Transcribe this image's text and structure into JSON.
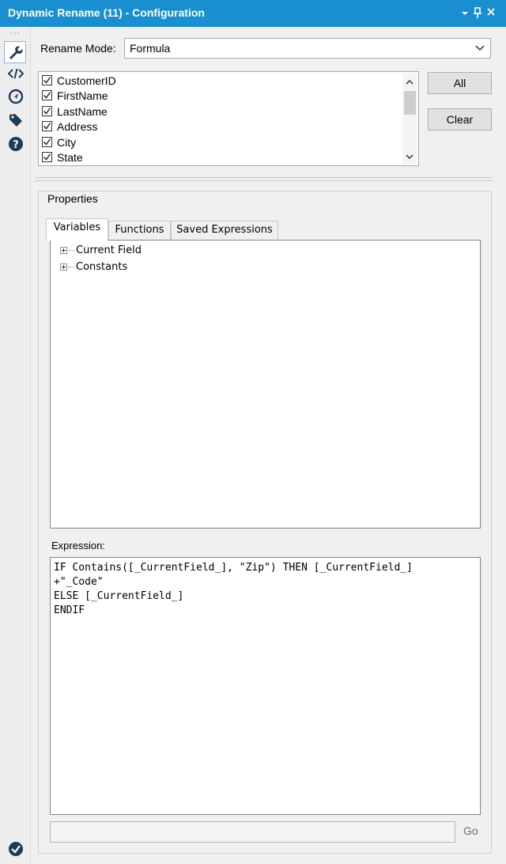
{
  "window": {
    "title": "Dynamic Rename (11) - Configuration",
    "buttons": {
      "dropdown": "▾",
      "pin": "📌",
      "close": "✕"
    }
  },
  "sidebar": {
    "dots": "···",
    "icons": [
      "wrench-icon",
      "code-icon",
      "compass-icon",
      "tag-icon",
      "help-icon"
    ],
    "bottom_icon": "check-circle-icon"
  },
  "rename_mode": {
    "label": "Rename Mode:",
    "value": "Formula"
  },
  "fields": [
    {
      "name": "CustomerID",
      "checked": true
    },
    {
      "name": "FirstName",
      "checked": true
    },
    {
      "name": "LastName",
      "checked": true
    },
    {
      "name": "Address",
      "checked": true
    },
    {
      "name": "City",
      "checked": true
    },
    {
      "name": "State",
      "checked": true
    }
  ],
  "buttons": {
    "all": "All",
    "clear": "Clear",
    "go": "Go"
  },
  "properties": {
    "title": "Properties",
    "tabs": [
      "Variables",
      "Functions",
      "Saved Expressions"
    ],
    "tree": [
      "Current Field",
      "Constants"
    ]
  },
  "expression": {
    "label": "Expression:",
    "text": "IF Contains([_CurrentField_], \"Zip\") THEN [_CurrentField_]\n+\"_Code\"\nELSE [_CurrentField_]\nENDIF"
  },
  "colors": {
    "titlebar": "#1a8fcf",
    "background": "#f0f0f0"
  }
}
